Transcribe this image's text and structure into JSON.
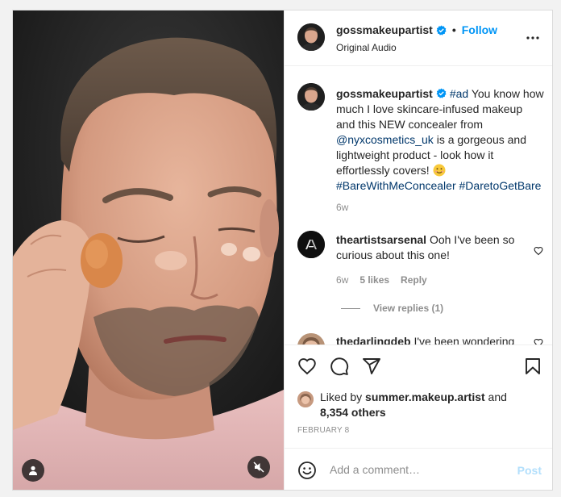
{
  "post": {
    "author": "gossmakeupartist",
    "follow_label": "Follow",
    "dot": "•",
    "audio": "Original Audio"
  },
  "caption": {
    "username": "gossmakeupartist",
    "parts": {
      "hashtag_ad": "#ad",
      "text1": " You know how much I love skincare-infused makeup and this NEW concealer from ",
      "mention": "@nyxcosmetics_uk",
      "text2": " is a gorgeous and lightweight product - look how it effortlessly covers! ",
      "tag1": "#BareWithMeConcealer",
      "tag2": "#DaretoGetBare"
    },
    "time": "6w"
  },
  "comments": [
    {
      "username": "theartistsarsenal",
      "text": " Ooh I've been so curious about this one!",
      "time": "6w",
      "likes": "5 likes",
      "reply": "Reply",
      "view_replies": "View replies (1)"
    },
    {
      "username": "thedarlingdeb",
      "text": " I've been wondering"
    }
  ],
  "likes": {
    "prefix": "Liked by ",
    "user": "summer.makeup.artist",
    "and": " and",
    "others": "8,354 others"
  },
  "date": "FEBRUARY 8",
  "add_comment": {
    "placeholder": "Add a comment…",
    "post_label": "Post"
  },
  "icons": {
    "verified": "verified-badge-icon",
    "more": "more-options-icon",
    "like": "heart-icon",
    "comment": "comment-icon",
    "share": "share-icon",
    "save": "bookmark-icon",
    "emoji": "smiley-icon",
    "user": "user-tag-icon",
    "mute": "muted-speaker-icon"
  },
  "colors": {
    "accent": "#0095f6",
    "link": "#00376b",
    "muted_text": "#8e8e8e",
    "post_disabled": "#b2dffc"
  }
}
